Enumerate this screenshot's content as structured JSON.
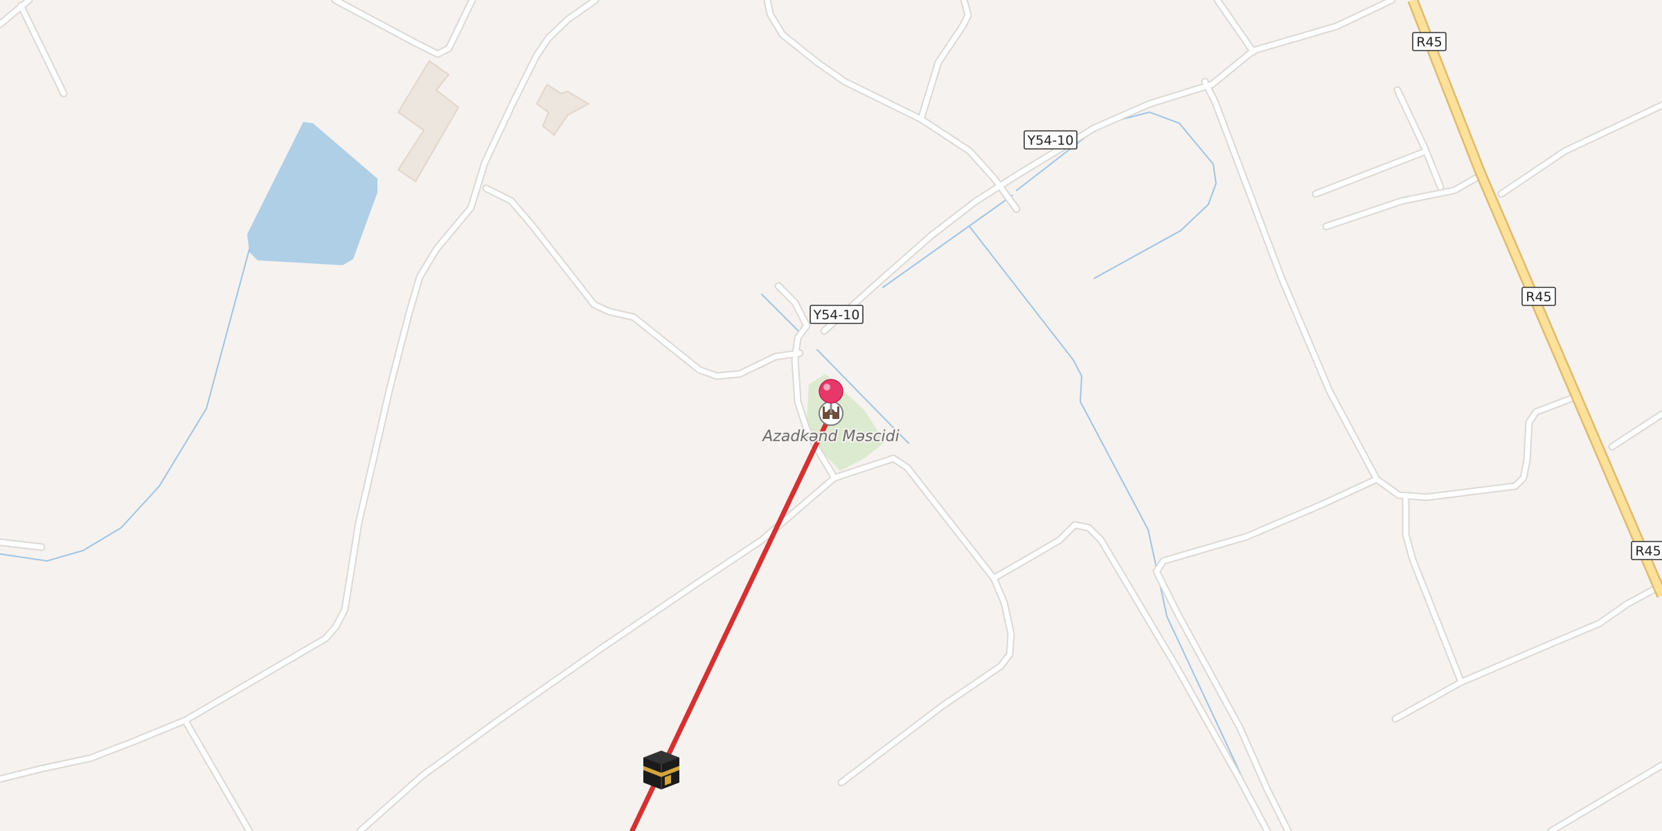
{
  "map": {
    "colors": {
      "background": "#f5f2ef",
      "road": "#ffffff",
      "road_casing": "#dcd8d4",
      "highway": "#fbe19a",
      "highway_casing": "#e3b96a",
      "water": "#aecfe5",
      "stream": "#9ec4e6",
      "park": "#dcebcf",
      "building": "#ede6df",
      "route_line": "#d63030",
      "pin": "#e8386a"
    },
    "road_shields": [
      {
        "id": "y54-10-a",
        "label": "Y54-10"
      },
      {
        "id": "y54-10-b",
        "label": "Y54-10"
      },
      {
        "id": "r45-a",
        "label": "R45"
      },
      {
        "id": "r45-b",
        "label": "R45"
      },
      {
        "id": "r45-c",
        "label": "R45"
      }
    ],
    "poi": {
      "label": "Azadkənd Məscidi",
      "icon": "mosque-icon"
    },
    "markers": {
      "location_pin": "map-pin-icon",
      "destination": "kaaba-icon"
    }
  }
}
